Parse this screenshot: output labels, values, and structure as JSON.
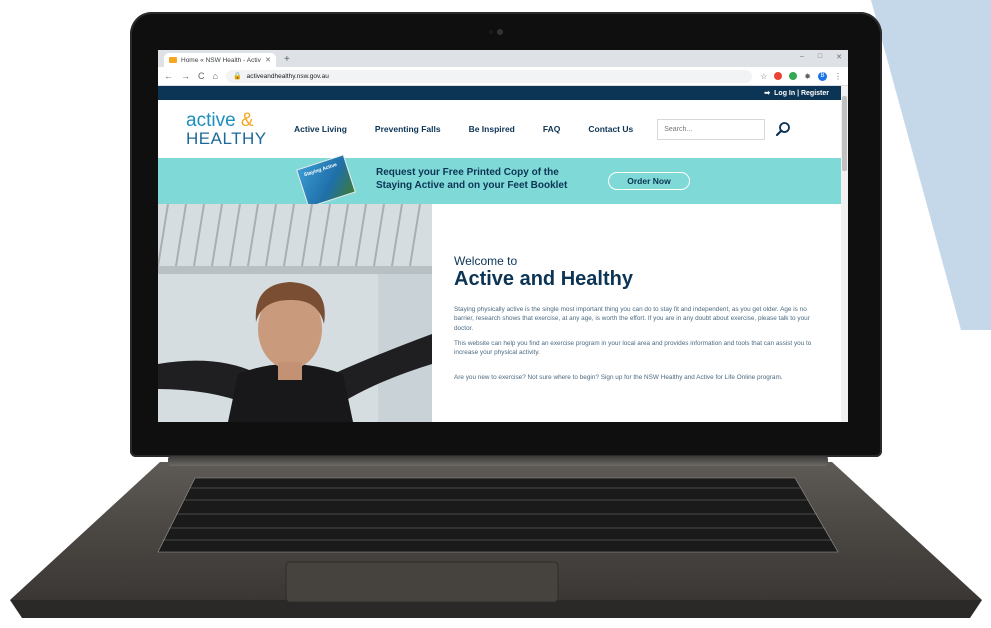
{
  "browser": {
    "tab_title": "Home « NSW Health - Active an",
    "tab_close": "✕",
    "new_tab": "+",
    "window_controls": [
      "–",
      "□",
      "✕"
    ],
    "nav": {
      "back": "←",
      "forward": "→",
      "reload": "C",
      "home": "⌂"
    },
    "url": "activeandhealthy.nsw.gov.au",
    "bookmark": "☆",
    "profile_initial": "B"
  },
  "utility_bar": {
    "login": "Log In | Register",
    "login_icon": "sign-in-icon"
  },
  "logo": {
    "line1": "active",
    "amp": "&",
    "line2": "HEALTHY"
  },
  "nav": [
    "Active Living",
    "Preventing Falls",
    "Be Inspired",
    "FAQ",
    "Contact Us"
  ],
  "search": {
    "placeholder": "Search..."
  },
  "banner": {
    "booklet_label": "Staying Active",
    "line1": "Request your Free Printed Copy of the",
    "line2": "Staying Active and on your Feet Booklet",
    "button": "Order Now"
  },
  "welcome": {
    "small": "Welcome to",
    "big": "Active and Healthy",
    "p1": "Staying physically active is the single most important thing you can do to stay fit and independent, as you get older. Age is no barrier, research shows that exercise, at any age, is worth the effort. If you are in any doubt about exercise, please talk to your doctor.",
    "p2": "This website can help you find an exercise program in your local area and provides information and tools that can assist you to increase your physical activity.",
    "p3": "Are you new to exercise? Not sure where to begin? Sign up for the NSW Healthy and Active for Life Online program."
  },
  "colors": {
    "navy": "#0c3455",
    "teal": "#7fd9d6",
    "brand_blue": "#1c8fbf",
    "orange": "#f5a623"
  }
}
